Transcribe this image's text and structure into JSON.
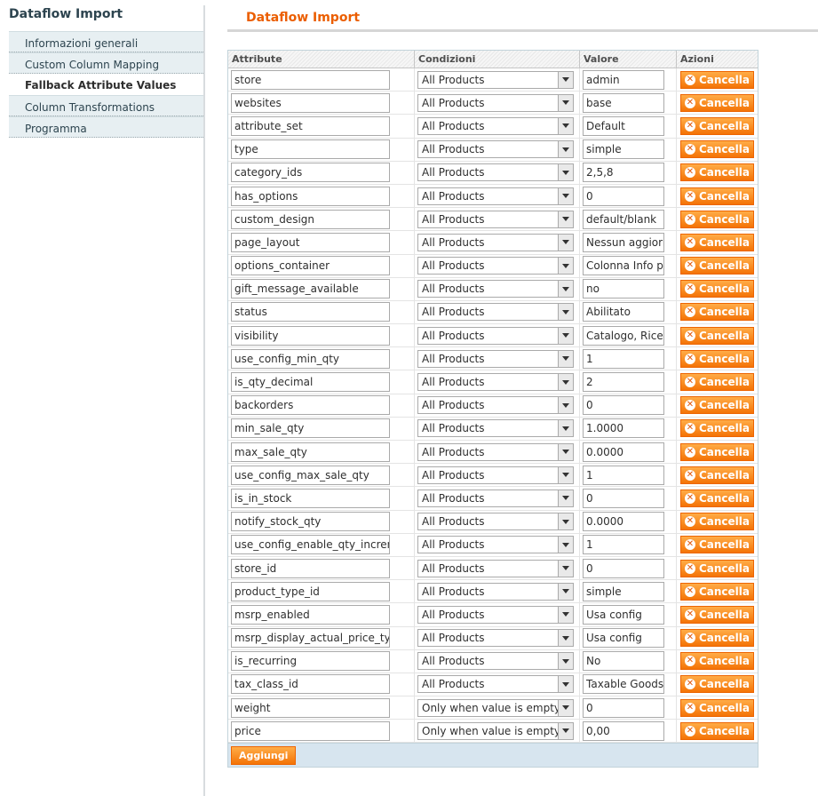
{
  "sidebar": {
    "title": "Dataflow Import",
    "items": [
      {
        "label": "Informazioni generali",
        "active": false
      },
      {
        "label": "Custom Column Mapping",
        "active": false
      },
      {
        "label": "Fallback Attribute Values",
        "active": true
      },
      {
        "label": "Column Transformations",
        "active": false
      },
      {
        "label": "Programma",
        "active": false
      }
    ]
  },
  "main": {
    "title": "Dataflow Import"
  },
  "grid": {
    "headers": [
      "Attribute",
      "Condizioni",
      "Valore",
      "Azioni"
    ],
    "cancel_label": "Cancella",
    "add_label": "Aggiungi",
    "rows": [
      {
        "attribute": "store",
        "condition": "All Products",
        "value": "admin"
      },
      {
        "attribute": "websites",
        "condition": "All Products",
        "value": "base"
      },
      {
        "attribute": "attribute_set",
        "condition": "All Products",
        "value": "Default"
      },
      {
        "attribute": "type",
        "condition": "All Products",
        "value": "simple"
      },
      {
        "attribute": "category_ids",
        "condition": "All Products",
        "value": "2,5,8"
      },
      {
        "attribute": "has_options",
        "condition": "All Products",
        "value": "0"
      },
      {
        "attribute": "custom_design",
        "condition": "All Products",
        "value": "default/blank"
      },
      {
        "attribute": "page_layout",
        "condition": "All Products",
        "value": "Nessun aggiorn"
      },
      {
        "attribute": "options_container",
        "condition": "All Products",
        "value": "Colonna Info pro"
      },
      {
        "attribute": "gift_message_available",
        "condition": "All Products",
        "value": "no"
      },
      {
        "attribute": "status",
        "condition": "All Products",
        "value": "Abilitato"
      },
      {
        "attribute": "visibility",
        "condition": "All Products",
        "value": "Catalogo, Ricer"
      },
      {
        "attribute": "use_config_min_qty",
        "condition": "All Products",
        "value": "1"
      },
      {
        "attribute": "is_qty_decimal",
        "condition": "All Products",
        "value": "2"
      },
      {
        "attribute": "backorders",
        "condition": "All Products",
        "value": "0"
      },
      {
        "attribute": "min_sale_qty",
        "condition": "All Products",
        "value": "1.0000"
      },
      {
        "attribute": "max_sale_qty",
        "condition": "All Products",
        "value": "0.0000"
      },
      {
        "attribute": "use_config_max_sale_qty",
        "condition": "All Products",
        "value": "1"
      },
      {
        "attribute": "is_in_stock",
        "condition": "All Products",
        "value": "0"
      },
      {
        "attribute": "notify_stock_qty",
        "condition": "All Products",
        "value": "0.0000"
      },
      {
        "attribute": "use_config_enable_qty_increm",
        "condition": "All Products",
        "value": "1"
      },
      {
        "attribute": "store_id",
        "condition": "All Products",
        "value": "0"
      },
      {
        "attribute": "product_type_id",
        "condition": "All Products",
        "value": "simple"
      },
      {
        "attribute": "msrp_enabled",
        "condition": "All Products",
        "value": "Usa config"
      },
      {
        "attribute": "msrp_display_actual_price_type",
        "condition": "All Products",
        "value": "Usa config"
      },
      {
        "attribute": "is_recurring",
        "condition": "All Products",
        "value": "No"
      },
      {
        "attribute": "tax_class_id",
        "condition": "All Products",
        "value": "Taxable Goods"
      },
      {
        "attribute": "weight",
        "condition": "Only when value is empty",
        "value": "0"
      },
      {
        "attribute": "price",
        "condition": "Only when value is empty",
        "value": "0,00"
      }
    ]
  }
}
